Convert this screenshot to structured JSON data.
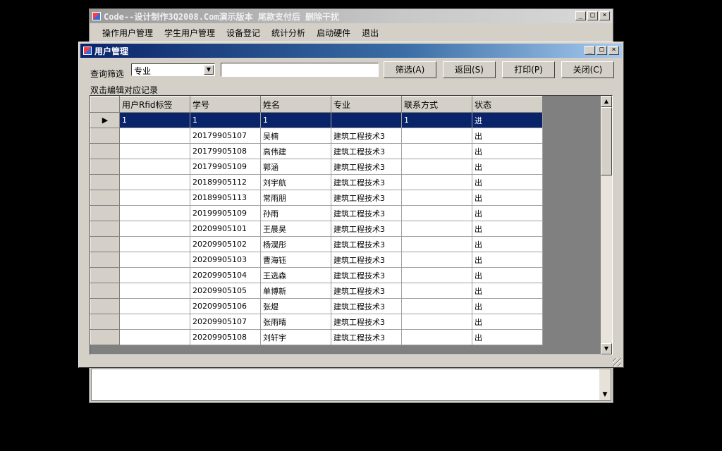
{
  "outer_window": {
    "title": "Code--设计制作3Q2008.Com演示版本  尾款支付后 删除干扰",
    "menu": [
      "操作用户管理",
      "学生用户管理",
      "设备登记",
      "统计分析",
      "启动硬件",
      "退出"
    ]
  },
  "window_buttons": {
    "minimize": "_",
    "maximize": "□",
    "close": "×"
  },
  "inner_window": {
    "title": "用户管理",
    "filter_label": "查询筛选",
    "filter_select": "专业",
    "search_value": "",
    "buttons": {
      "filter": "筛选(A)",
      "back": "返回(S)",
      "print": "打印(P)",
      "close": "关闭(C)"
    },
    "hint": "双击编辑对应记录"
  },
  "grid": {
    "columns": [
      "用户Rfid标签",
      "学号",
      "姓名",
      "专业",
      "联系方式",
      "状态"
    ],
    "selected_row": 0,
    "row_indicator": "▶",
    "rows": [
      [
        "1",
        "1",
        "1",
        "",
        "1",
        "进"
      ],
      [
        "",
        "20179905107",
        "吴楠",
        "建筑工程技术3",
        "",
        "出"
      ],
      [
        "",
        "20179905108",
        "高伟建",
        "建筑工程技术3",
        "",
        "出"
      ],
      [
        "",
        "20179905109",
        "郭涵",
        "建筑工程技术3",
        "",
        "出"
      ],
      [
        "",
        "20189905112",
        "刘宇航",
        "建筑工程技术3",
        "",
        "出"
      ],
      [
        "",
        "20189905113",
        "常雨朋",
        "建筑工程技术3",
        "",
        "出"
      ],
      [
        "",
        "20199905109",
        "孙雨",
        "建筑工程技术3",
        "",
        "出"
      ],
      [
        "",
        "20209905101",
        "王晨昊",
        "建筑工程技术3",
        "",
        "出"
      ],
      [
        "",
        "20209905102",
        "杨淏彤",
        "建筑工程技术3",
        "",
        "出"
      ],
      [
        "",
        "20209905103",
        "曹海钰",
        "建筑工程技术3",
        "",
        "出"
      ],
      [
        "",
        "20209905104",
        "王选森",
        "建筑工程技术3",
        "",
        "出"
      ],
      [
        "",
        "20209905105",
        "单博新",
        "建筑工程技术3",
        "",
        "出"
      ],
      [
        "",
        "20209905106",
        "张煜",
        "建筑工程技术3",
        "",
        "出"
      ],
      [
        "",
        "20209905107",
        "张雨晴",
        "建筑工程技术3",
        "",
        "出"
      ],
      [
        "",
        "20209905108",
        "刘轩宇",
        "建筑工程技术3",
        "",
        "出"
      ]
    ]
  }
}
